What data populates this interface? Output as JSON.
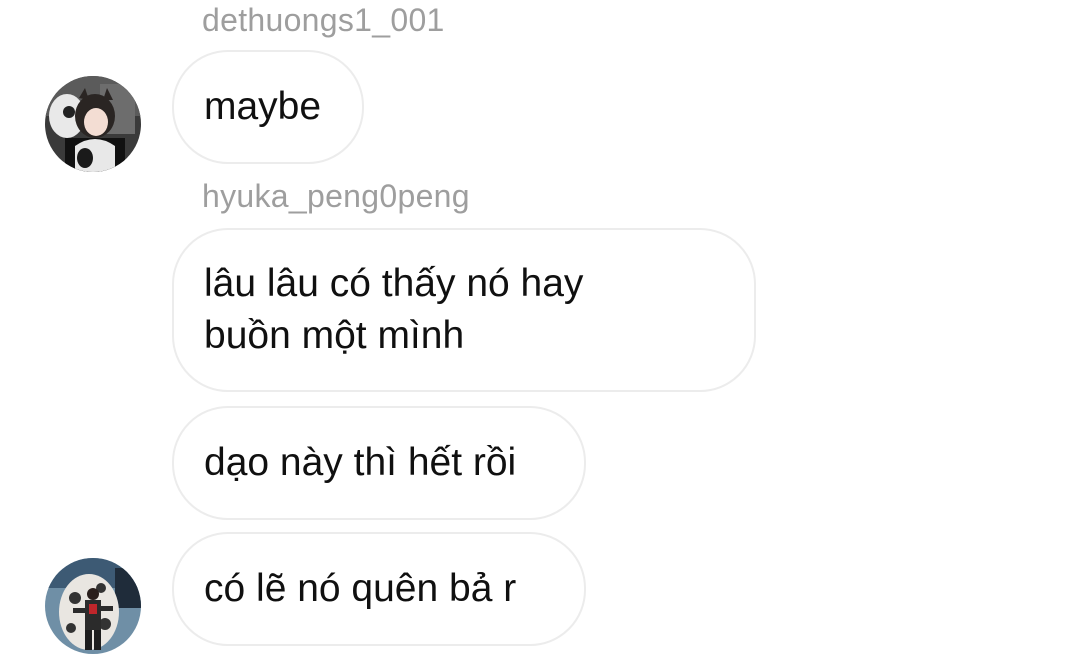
{
  "thread": {
    "messages": [
      {
        "sender": "dethuongs1_001",
        "text": "maybe"
      },
      {
        "sender": "hyuka_peng0peng",
        "text": "lâu lâu có thấy nó hay buồn một mình"
      },
      {
        "text": "dạo này thì hết rồi"
      },
      {
        "text": "có lẽ nó quên bả r"
      }
    ]
  }
}
